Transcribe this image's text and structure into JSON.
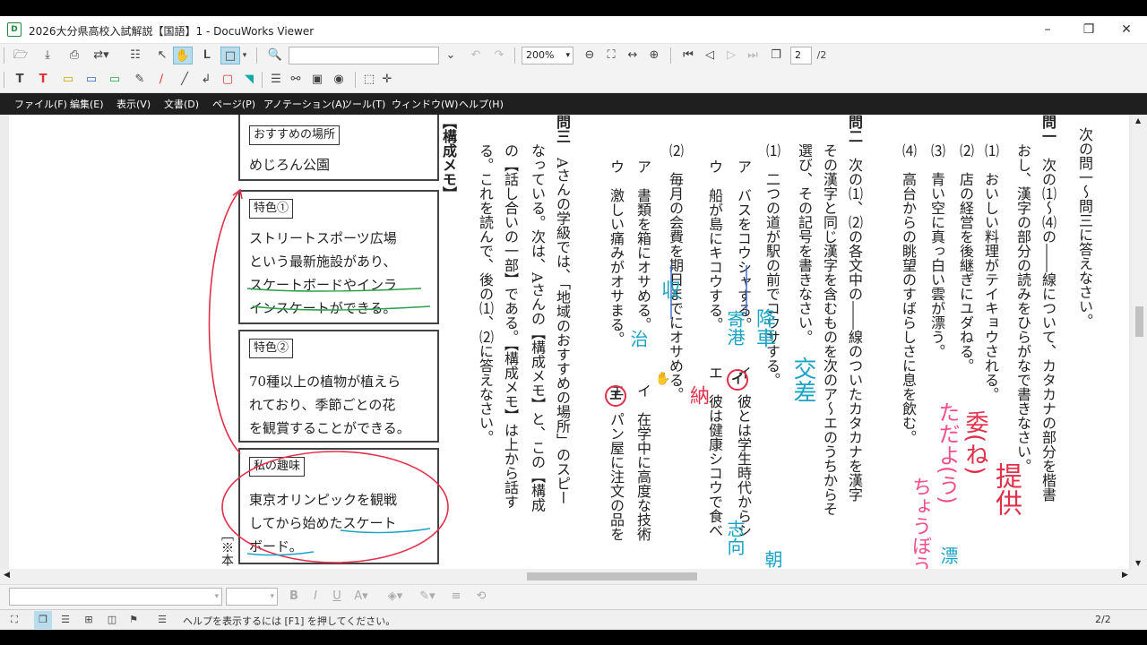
{
  "window": {
    "title": "2026大分県高校入試解説【国語】1 - DocuWorks Viewer",
    "app_icon": "docuworks-icon",
    "controls": [
      "minimize",
      "restore",
      "close"
    ]
  },
  "toolbar": {
    "zoom": "200%",
    "page_input": "2",
    "page_total": "/2",
    "search_placeholder": ""
  },
  "menu": [
    "ファイル(F)",
    "編集(E)",
    "表示(V)",
    "文書(D)",
    "ページ(P)",
    "アノテーション(A)",
    "ツール(T)",
    "ウィンドウ(W)",
    "ヘルプ(H)"
  ],
  "document": {
    "q_header": "次の問一～問三に答えなさい。",
    "q1_head": "問一",
    "q1_text_1": "次の⑴～⑷の――線について、カタカナの部分を楷書",
    "q1_text_2": "おし、漢字の部分の読みをひらがなで書きなさい。",
    "q1_items": [
      "⑴　おいしい料理がテイキョウされる。",
      "⑵　店の経営を後継ぎにユダねる。",
      "⑶　青い空に真っ白い雲が漂う。",
      "⑷　高台からの眺望のすばらしさに息を飲む。"
    ],
    "q2_head": "問二",
    "q2_text_1": "次の⑴、⑵の各文中の――線のついたカタカナを漢字",
    "q2_text_2": "その漢字と同じ漢字を含むものを次のア～エのうちからそ",
    "q2_text_3": "選び、その記号を書きなさい。",
    "q2_1_lead": "⑴　二つの道が駅の前でコウサする。",
    "q2_1_a": "ア　バスをコウシャする。",
    "q2_1_b": "イ　彼とは学生時代からシ",
    "q2_1_c": "ウ　船が島にキコウする。",
    "q2_1_d": "エ　彼は健康シコウで食べ",
    "q2_2_lead": "⑵　毎月の会費を期日までにオサめる。",
    "q2_2_a": "ア　書類を箱にオサめる。",
    "q2_2_b": "イ　在学中に高度な技術",
    "q2_2_c": "ウ　激しい痛みがオサまる。",
    "q2_2_d": "エ　パン屋に注文の品を",
    "q3_head": "問三",
    "q3_text_1": "Aさんの学級では、「地域のおすすめの場所」のスピー",
    "q3_text_2": "なっている。次は、Aさんの【構成メモ】と、この【構成",
    "q3_text_3": "の【話し合いの一部】である。【構成メモ】は上から話す",
    "q3_text_4": "る。これを読んで、後の⑴、⑵に答えなさい。",
    "memo_label": "【構成メモ】",
    "note_mark": "［※本",
    "box1_tag": "おすすめの場所",
    "box1_text": "めじろん公園",
    "box2_tag": "特色①",
    "box2_lines": [
      "ストリートスポーツ広場",
      "という最新施設があり、",
      "スケートボードやインラ",
      "インスケートができる。"
    ],
    "box3_tag": "特色②",
    "box3_lines": [
      "70種以上の植物が植えら",
      "れており、季節ごとの花",
      "を観賞することができる。"
    ],
    "box4_tag": "私の趣味",
    "box4_lines": [
      "東京オリンピックを観戦",
      "してから始めたスケート",
      "ボード。"
    ]
  },
  "annotations": {
    "red_1": "委(ね)",
    "red_2": "提供",
    "pink_1": "ただよ(う)",
    "pink_2": "ちょうぼう",
    "teal_1": "漂",
    "teal_2": "交差",
    "teal_3": "降車",
    "teal_4": "寄港",
    "teal_5": "志向",
    "teal_6": "収",
    "teal_7": "治",
    "teal_8": "納",
    "teal_9": "朝",
    "circle_i": "イ",
    "circle_e": "エ",
    "colors": {
      "red": "#e0304a",
      "pink": "#ef4f8c",
      "teal": "#1ba3c4",
      "ink": "#222222"
    }
  },
  "status": {
    "help": "ヘルプを表示するには [F1] を押してください。",
    "page": "2/2"
  }
}
